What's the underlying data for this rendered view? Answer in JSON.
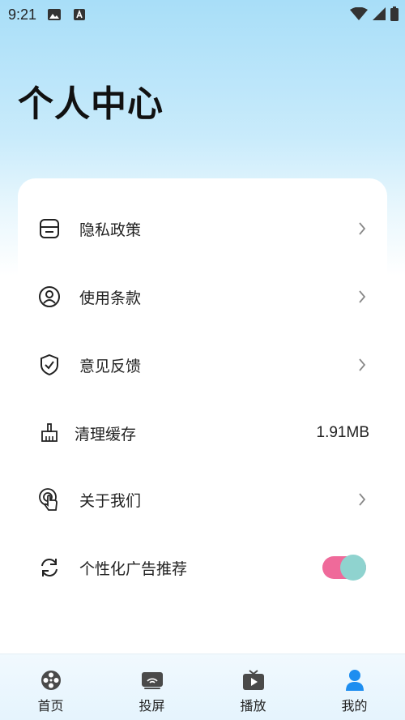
{
  "status_bar": {
    "time": "9:21"
  },
  "page": {
    "title": "个人中心"
  },
  "menu": {
    "items": [
      {
        "label": "隐私政策",
        "icon": "privacy-document-icon",
        "chevron": true
      },
      {
        "label": "使用条款",
        "icon": "user-circle-icon",
        "chevron": true
      },
      {
        "label": "意见反馈",
        "icon": "shield-check-icon",
        "chevron": true
      },
      {
        "label": "清理缓存",
        "icon": "broom-icon",
        "value": "1.91MB"
      },
      {
        "label": "关于我们",
        "icon": "touch-hand-icon",
        "chevron": true
      },
      {
        "label": "个性化广告推荐",
        "icon": "refresh-icon",
        "toggle": true
      }
    ]
  },
  "ad_toggle": {
    "state": "on"
  },
  "tabbar": {
    "tabs": [
      {
        "label": "首页",
        "icon": "film-reel-icon",
        "active": false
      },
      {
        "label": "投屏",
        "icon": "cast-screen-icon",
        "active": false
      },
      {
        "label": "播放",
        "icon": "tv-play-icon",
        "active": false
      },
      {
        "label": "我的",
        "icon": "person-icon",
        "active": true
      }
    ]
  },
  "colors": {
    "accent": "#1e8ef0",
    "toggle_track": "#ef6a9a",
    "toggle_knob": "#8fd3cf",
    "header_gradient_top": "#a8def8"
  }
}
